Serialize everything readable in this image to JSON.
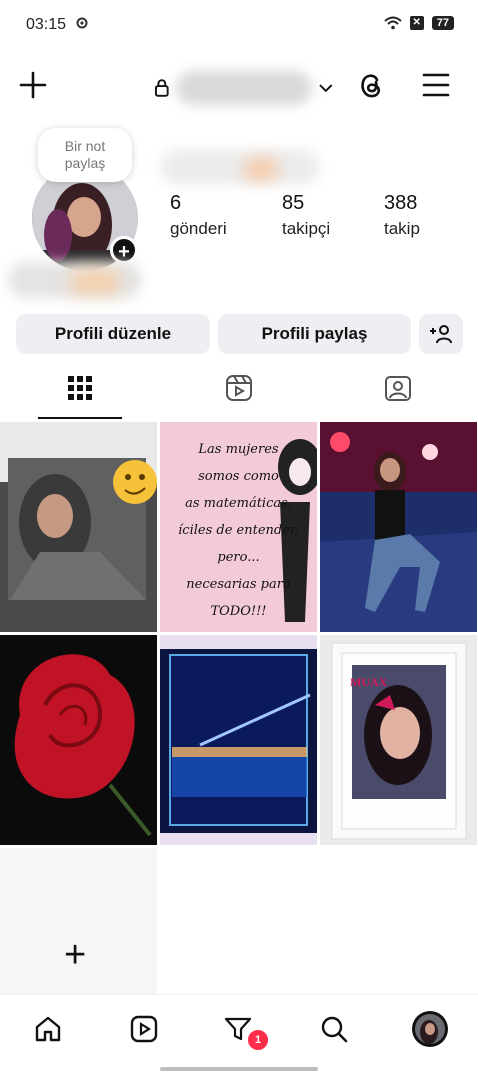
{
  "status_bar": {
    "time": "03:15",
    "battery": "77"
  },
  "header": {
    "username": "",
    "icons": [
      "plus-icon",
      "lock-icon",
      "chevron-down-icon",
      "threads-icon",
      "menu-icon"
    ]
  },
  "profile": {
    "note": {
      "line1": "Bir not",
      "line2": "paylaş"
    },
    "stats": [
      {
        "value": "6",
        "label": "gönderi"
      },
      {
        "value": "85",
        "label": "takipçi"
      },
      {
        "value": "388",
        "label": "takip"
      }
    ]
  },
  "actions": {
    "edit": "Profili düzenle",
    "share": "Profili paylaş"
  },
  "tabs": [
    "grid-icon",
    "reels-icon",
    "tagged-icon"
  ],
  "posts": [
    {
      "caption": ""
    },
    {
      "lines": [
        "Las mujeres",
        "somos como",
        "as matemáticas,",
        "íciles de entender,",
        "pero...",
        "necesarias para",
        "TODO!!!"
      ]
    },
    {
      "caption": ""
    },
    {
      "caption": ""
    },
    {
      "caption": ""
    },
    {
      "caption": "MUAX"
    }
  ],
  "add_tile": {
    "label": "+"
  },
  "bottom_nav": {
    "badge": "1",
    "items": [
      "home-icon",
      "reels-icon",
      "activity-icon",
      "search-icon",
      "profile-avatar"
    ]
  },
  "colors": {
    "accent": "#ff2d4a",
    "button_bg": "#efeff3"
  }
}
